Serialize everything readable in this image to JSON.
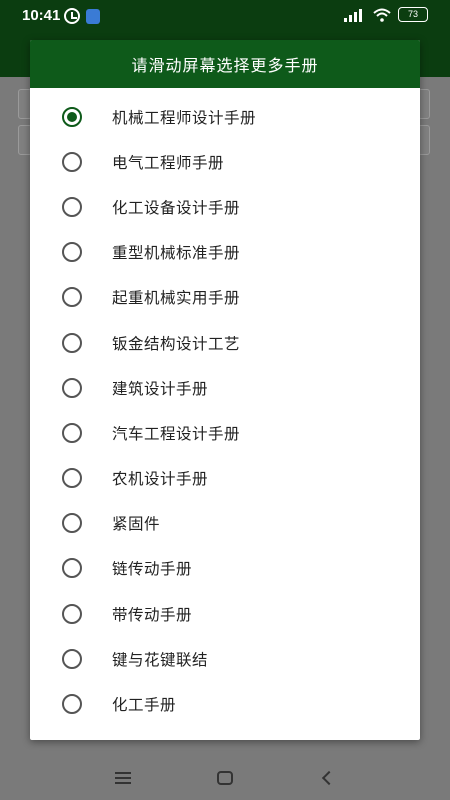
{
  "status_bar": {
    "time": "10:41",
    "battery": "73"
  },
  "dialog": {
    "title": "请滑动屏幕选择更多手册",
    "options": [
      {
        "label": "机械工程师设计手册",
        "checked": true
      },
      {
        "label": "电气工程师手册",
        "checked": false
      },
      {
        "label": "化工设备设计手册",
        "checked": false
      },
      {
        "label": "重型机械标准手册",
        "checked": false
      },
      {
        "label": "起重机械实用手册",
        "checked": false
      },
      {
        "label": "钣金结构设计工艺",
        "checked": false
      },
      {
        "label": "建筑设计手册",
        "checked": false
      },
      {
        "label": "汽车工程设计手册",
        "checked": false
      },
      {
        "label": "农机设计手册",
        "checked": false
      },
      {
        "label": "紧固件",
        "checked": false
      },
      {
        "label": "链传动手册",
        "checked": false
      },
      {
        "label": "带传动手册",
        "checked": false
      },
      {
        "label": "键与花键联结",
        "checked": false
      },
      {
        "label": "化工手册",
        "checked": false
      }
    ]
  },
  "nav": {
    "icons": [
      "menu-icon",
      "home-icon",
      "back-icon"
    ]
  }
}
